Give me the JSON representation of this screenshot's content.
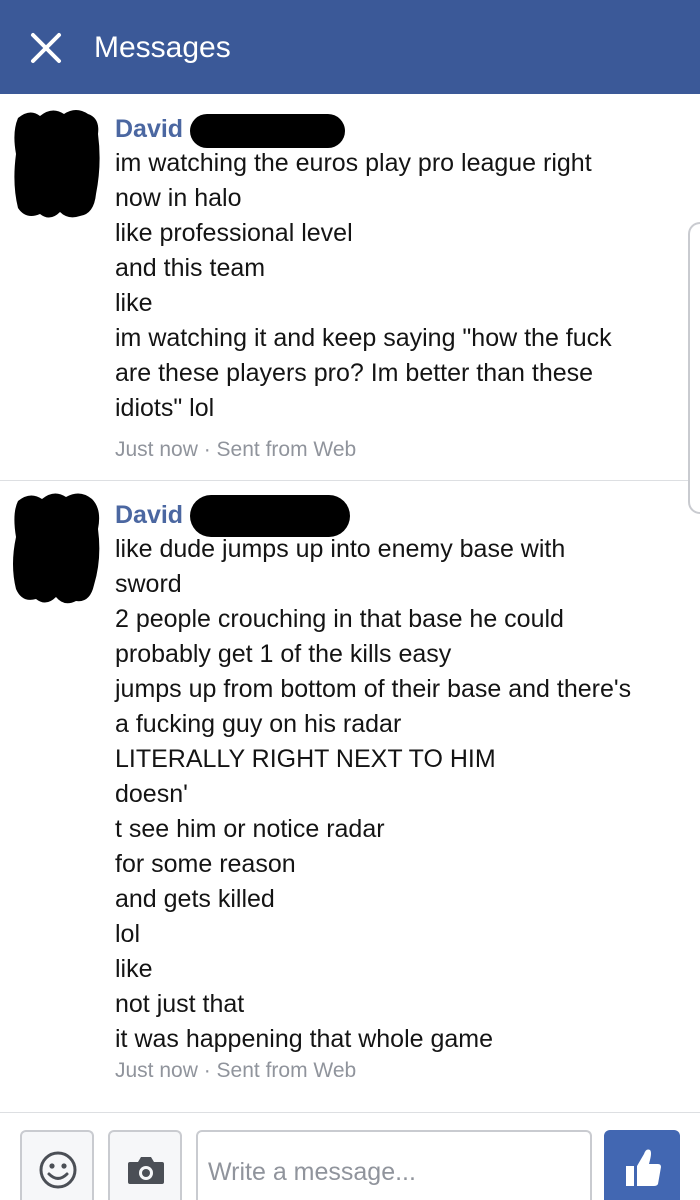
{
  "header": {
    "title": "Messages",
    "close_icon": "close-icon",
    "background": "#3b5998"
  },
  "messages": [
    {
      "sender": "David",
      "lines": [
        "im watching the euros play pro league right",
        "now in halo",
        "like professional level",
        "and this team",
        "like",
        "im watching it and keep saying \"how the fuck",
        "are these players pro? Im better than these",
        "idiots\" lol"
      ],
      "meta": "Just now · Sent from Web"
    },
    {
      "sender": "David",
      "lines": [
        "like dude jumps up into enemy base with",
        "sword",
        "2 people crouching in that base he could",
        "probably get 1 of the kills easy",
        "jumps up from bottom of their base and there's",
        "a fucking guy on his radar",
        "LITERALLY RIGHT NEXT TO HIM",
        "doesn'",
        "t see him or notice radar",
        "for some reason",
        "and gets killed",
        "lol",
        "like",
        "not just that",
        "it was happening that whole game"
      ],
      "meta": "Just now · Sent from Web"
    }
  ],
  "composer": {
    "placeholder": "Write a message...",
    "value": "",
    "emoji_icon": "smiley-icon",
    "camera_icon": "camera-icon",
    "like_icon": "thumbs-up-icon",
    "accent": "#4267b2"
  }
}
